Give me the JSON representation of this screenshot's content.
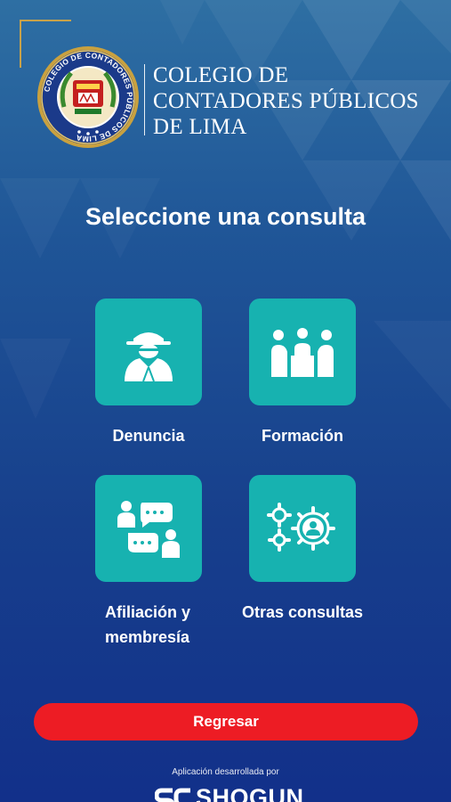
{
  "header": {
    "logo_lines": [
      "COLEGIO DE",
      "CONTADORES PÚBLICOS",
      "DE LIMA"
    ],
    "seal_text": "COLEGIO DE CONTADORES PÚBLICOS DE LIMA"
  },
  "title": "Seleccione una consulta",
  "options": [
    {
      "label": "Denuncia",
      "icon": "detective-icon"
    },
    {
      "label": "Formación",
      "icon": "group-meeting-icon"
    },
    {
      "label_line1": "Afiliación y",
      "label_line2": "membresía",
      "icon": "chat-people-icon"
    },
    {
      "label": "Otras consultas",
      "icon": "gears-user-icon"
    }
  ],
  "back_button": "Regresar",
  "footer": {
    "credit": "Aplicación desarrollada por",
    "brand": "SHOGUN"
  },
  "colors": {
    "tile": "#17b2b0",
    "button": "#ed1c24",
    "accent_gold": "#c8a24a"
  }
}
